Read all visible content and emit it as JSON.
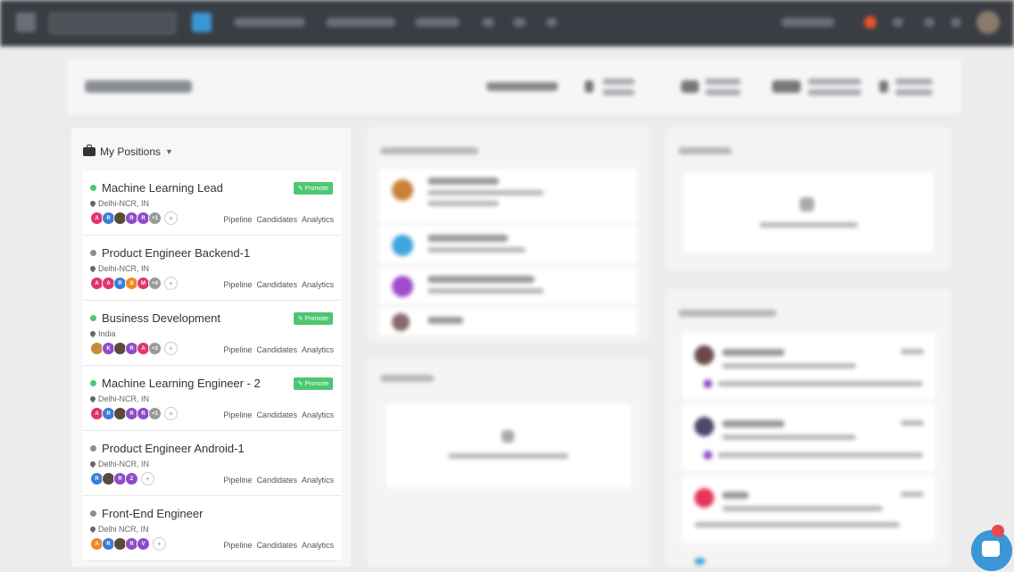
{
  "positions_panel": {
    "title": "My Positions",
    "items": [
      {
        "title": "Machine Learning Lead",
        "status": "active",
        "location": "Delhi-NCR, IN",
        "promote": "Promote",
        "avatars": [
          {
            "l": "A",
            "c": "#e0356c"
          },
          {
            "l": "R",
            "c": "#3b7dd8"
          },
          {
            "l": "",
            "c": "#5a4a3a"
          },
          {
            "l": "R",
            "c": "#8e4cc9"
          },
          {
            "l": "R",
            "c": "#8e4cc9"
          },
          {
            "l": "+1",
            "c": "#999"
          }
        ]
      },
      {
        "title": "Product Engineer Backend-1",
        "status": "inactive",
        "location": "Delhi-NCR, IN",
        "promote": "",
        "avatars": [
          {
            "l": "A",
            "c": "#e0356c"
          },
          {
            "l": "A",
            "c": "#e0356c"
          },
          {
            "l": "R",
            "c": "#3b7dd8"
          },
          {
            "l": "S",
            "c": "#f08a24"
          },
          {
            "l": "M",
            "c": "#e0356c"
          },
          {
            "l": "+4",
            "c": "#999"
          }
        ]
      },
      {
        "title": "Business Development",
        "status": "active",
        "location": "India",
        "promote": "Promote",
        "avatars": [
          {
            "l": "",
            "c": "#c98a3a"
          },
          {
            "l": "K",
            "c": "#8e4cc9"
          },
          {
            "l": "",
            "c": "#5a4a3a"
          },
          {
            "l": "R",
            "c": "#8e4cc9"
          },
          {
            "l": "A",
            "c": "#e0356c"
          },
          {
            "l": "+2",
            "c": "#999"
          }
        ]
      },
      {
        "title": "Machine Learning Engineer - 2",
        "status": "active",
        "location": "Delhi-NCR, IN",
        "promote": "Promote",
        "avatars": [
          {
            "l": "A",
            "c": "#e0356c"
          },
          {
            "l": "R",
            "c": "#3b7dd8"
          },
          {
            "l": "",
            "c": "#5a4a3a"
          },
          {
            "l": "R",
            "c": "#8e4cc9"
          },
          {
            "l": "R",
            "c": "#8e4cc9"
          },
          {
            "l": "+1",
            "c": "#999"
          }
        ]
      },
      {
        "title": "Product Engineer Android-1",
        "status": "inactive",
        "location": "Delhi-NCR, IN",
        "promote": "",
        "avatars": [
          {
            "l": "R",
            "c": "#3b7dd8"
          },
          {
            "l": "",
            "c": "#5a4a3a"
          },
          {
            "l": "R",
            "c": "#8e4cc9"
          },
          {
            "l": "Z",
            "c": "#8e4cc9"
          }
        ]
      },
      {
        "title": "Front-End Engineer",
        "status": "inactive",
        "location": "Delhi NCR, IN",
        "promote": "",
        "avatars": [
          {
            "l": "A",
            "c": "#f08a24"
          },
          {
            "l": "R",
            "c": "#3b7dd8"
          },
          {
            "l": "",
            "c": "#5a4a3a"
          },
          {
            "l": "R",
            "c": "#8e4cc9"
          },
          {
            "l": "V",
            "c": "#8e4cc9"
          }
        ]
      }
    ],
    "links": [
      "Pipeline",
      "Candidates",
      "Analytics"
    ]
  },
  "icons": [
    "briefcase-icon",
    "caret-down-icon",
    "map-pin-icon",
    "megaphone-icon",
    "chat-icon"
  ],
  "colors": {
    "active": "#4cc771",
    "topbar": "#3a3d44",
    "accent": "#3b96d6"
  }
}
